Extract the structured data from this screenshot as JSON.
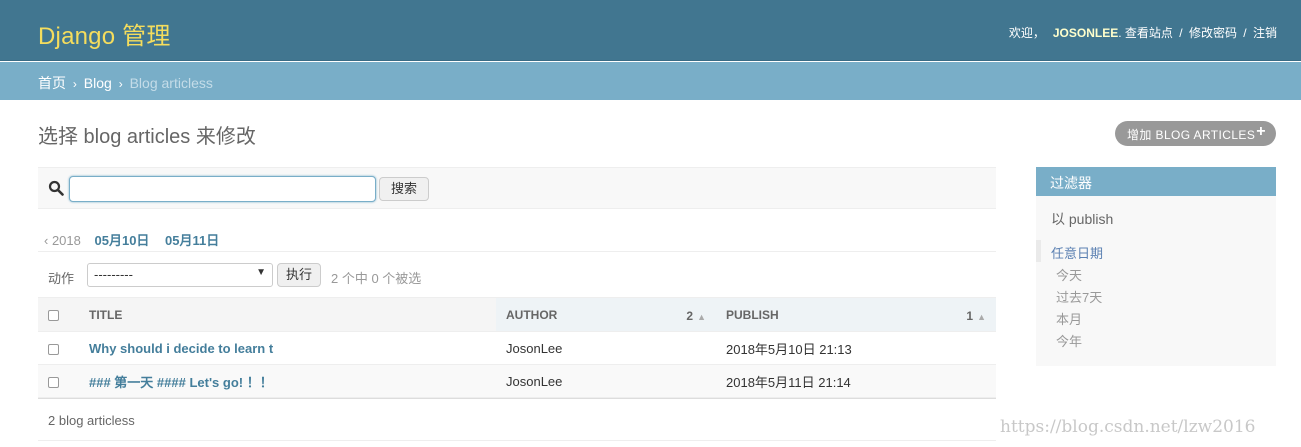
{
  "header": {
    "brand": "Django 管理",
    "welcome": "欢迎，",
    "username": "JOSONLEE",
    "view_site": "查看站点",
    "change_password": "修改密码",
    "logout": "注销",
    "sep": "/"
  },
  "breadcrumbs": {
    "home": "首页",
    "app": "Blog",
    "current": "Blog articless",
    "sep": "›"
  },
  "content": {
    "title": "选择 blog articles 来修改",
    "add_button": "增加 BLOG ARTICLES",
    "add_icon": "plus-icon"
  },
  "search": {
    "value": "",
    "button": "搜索",
    "icon": "search-icon"
  },
  "date_hierarchy": {
    "back": "‹ 2018",
    "items": [
      "05月10日",
      "05月11日"
    ]
  },
  "actions": {
    "label": "动作",
    "selected": "---------",
    "go": "执行",
    "counter": "2 个中 0 个被选"
  },
  "table": {
    "headers": {
      "title": "TITLE",
      "author": "AUTHOR",
      "author_sort_priority": "2",
      "publish": "PUBLISH",
      "publish_sort_priority": "1"
    },
    "rows": [
      {
        "title": "Why should i decide to learn t",
        "author": "JosonLee",
        "publish": "2018年5月10日 21:13"
      },
      {
        "title": "### 第一天 #### Let's go! ！！",
        "author": "JosonLee",
        "publish": "2018年5月11日 21:14"
      }
    ]
  },
  "paginator": "2 blog articless",
  "filter": {
    "title": "过滤器",
    "group": "以 publish",
    "items": [
      "任意日期",
      "今天",
      "过去7天",
      "本月",
      "今年"
    ]
  },
  "watermark": "https://blog.csdn.net/lzw2016",
  "colors": {
    "header_bg": "#417690",
    "brand": "#f5dd5d",
    "breadcrumb_bg": "#79aec8",
    "link": "#447e9b",
    "add_button_bg": "#999999"
  }
}
